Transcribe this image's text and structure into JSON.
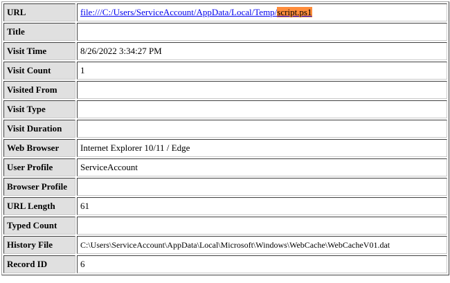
{
  "rows": [
    {
      "label": "URL",
      "value_prefix": "file:///C:/Users/ServiceAccount/AppData/Local/Temp/",
      "value_highlight": "script.ps1"
    },
    {
      "label": "Title",
      "value": ""
    },
    {
      "label": "Visit Time",
      "value": "8/26/2022 3:34:27 PM"
    },
    {
      "label": "Visit Count",
      "value": "1"
    },
    {
      "label": "Visited From",
      "value": ""
    },
    {
      "label": "Visit Type",
      "value": ""
    },
    {
      "label": "Visit Duration",
      "value": ""
    },
    {
      "label": "Web Browser",
      "value": "Internet Explorer 10/11 / Edge"
    },
    {
      "label": "User Profile",
      "value": "ServiceAccount"
    },
    {
      "label": "Browser Profile",
      "value": ""
    },
    {
      "label": "URL Length",
      "value": "61"
    },
    {
      "label": "Typed Count",
      "value": ""
    },
    {
      "label": "History File",
      "value": "C:\\Users\\ServiceAccount\\AppData\\Local\\Microsoft\\Windows\\WebCache\\WebCacheV01.dat"
    },
    {
      "label": "Record ID",
      "value": "6"
    }
  ],
  "colors": {
    "label_bg": "#e0e0e0",
    "link": "#0000ee",
    "highlight": "#ff8c3a"
  }
}
